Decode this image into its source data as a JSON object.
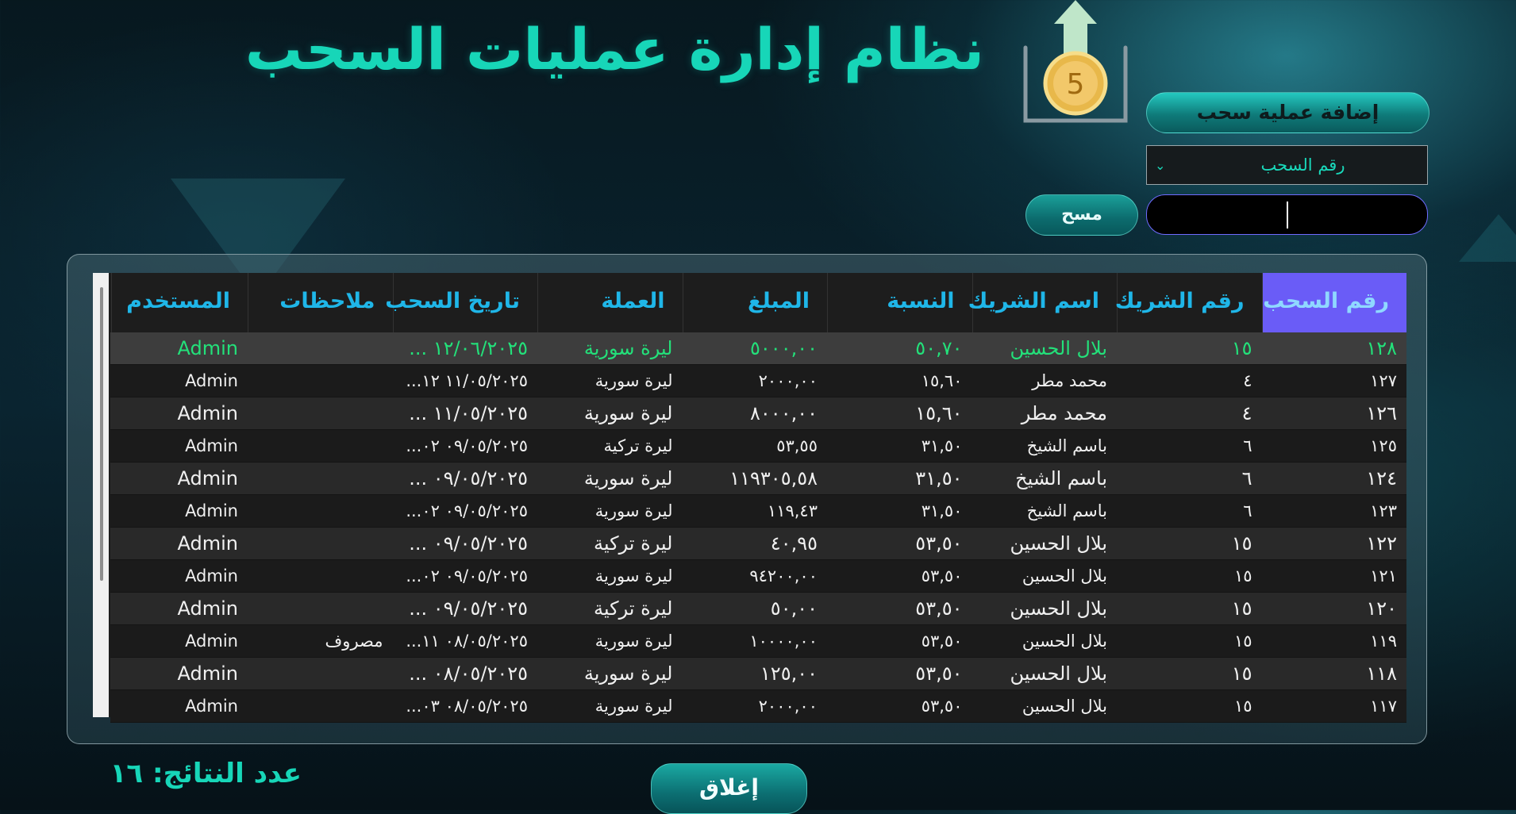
{
  "header": {
    "title": "نظام إدارة عمليات السحب",
    "logo_number": "5"
  },
  "controls": {
    "add_button": "إضافة عملية سحب",
    "search_field_select": "رقم السحب",
    "search_value": "",
    "clear_button": "مسح"
  },
  "table": {
    "columns": [
      "رقم السحب",
      "رقم الشريك",
      "اسم الشريك",
      "النسبة",
      "المبلغ",
      "العملة",
      "تاريخ السحب",
      "ملاحظات",
      "المستخدم"
    ],
    "rows": [
      [
        "١٢٨",
        "١٥",
        "بلال الحسين",
        "٥٠,٧٠",
        "٥٠٠٠,٠٠",
        "ليرة سورية",
        "١٢/٠٦/٢٠٢٥ ...",
        "",
        "Admin"
      ],
      [
        "١٢٧",
        "٤",
        "محمد مطر",
        "١٥,٦٠",
        "٢٠٠٠,٠٠",
        "ليرة سورية",
        "١١/٠٥/٢٠٢٥ ١٢...",
        "",
        "Admin"
      ],
      [
        "١٢٦",
        "٤",
        "محمد مطر",
        "١٥,٦٠",
        "٨٠٠٠,٠٠",
        "ليرة سورية",
        "١١/٠٥/٢٠٢٥ ...",
        "",
        "Admin"
      ],
      [
        "١٢٥",
        "٦",
        "باسم الشيخ",
        "٣١,٥٠",
        "٥٣,٥٥",
        "ليرة تركية",
        "٠٩/٠٥/٢٠٢٥ ٠٢...",
        "",
        "Admin"
      ],
      [
        "١٢٤",
        "٦",
        "باسم الشيخ",
        "٣١,٥٠",
        "١١٩٣٠٥,٥٨",
        "ليرة سورية",
        "٠٩/٠٥/٢٠٢٥ ...",
        "",
        "Admin"
      ],
      [
        "١٢٣",
        "٦",
        "باسم الشيخ",
        "٣١,٥٠",
        "١١٩,٤٣",
        "ليرة سورية",
        "٠٩/٠٥/٢٠٢٥ ٠٢...",
        "",
        "Admin"
      ],
      [
        "١٢٢",
        "١٥",
        "بلال الحسين",
        "٥٣,٥٠",
        "٤٠,٩٥",
        "ليرة تركية",
        "٠٩/٠٥/٢٠٢٥ ...",
        "",
        "Admin"
      ],
      [
        "١٢١",
        "١٥",
        "بلال الحسين",
        "٥٣,٥٠",
        "٩٤٢٠٠,٠٠",
        "ليرة سورية",
        "٠٩/٠٥/٢٠٢٥ ٠٢...",
        "",
        "Admin"
      ],
      [
        "١٢٠",
        "١٥",
        "بلال الحسين",
        "٥٣,٥٠",
        "٥٠,٠٠",
        "ليرة تركية",
        "٠٩/٠٥/٢٠٢٥ ...",
        "",
        "Admin"
      ],
      [
        "١١٩",
        "١٥",
        "بلال الحسين",
        "٥٣,٥٠",
        "١٠٠٠٠,٠٠",
        "ليرة سورية",
        "٠٨/٠٥/٢٠٢٥ ١١...",
        "مصروف",
        "Admin"
      ],
      [
        "١١٨",
        "١٥",
        "بلال الحسين",
        "٥٣,٥٠",
        "١٢٥,٠٠",
        "ليرة سورية",
        "٠٨/٠٥/٢٠٢٥ ...",
        "",
        "Admin"
      ],
      [
        "١١٧",
        "١٥",
        "بلال الحسين",
        "٥٣,٥٠",
        "٢٠٠٠,٠٠",
        "ليرة سورية",
        "٠٨/٠٥/٢٠٢٥ ٠٣...",
        "",
        "Admin"
      ]
    ]
  },
  "footer": {
    "result_count": "عدد النتائج: ١٦",
    "close_button": "إغلاق"
  },
  "colors": {
    "accent": "#17d6b8",
    "header_text": "#1fb6e8",
    "active_header": "#6a5cf7",
    "selected_row_text": "#23e17a"
  }
}
